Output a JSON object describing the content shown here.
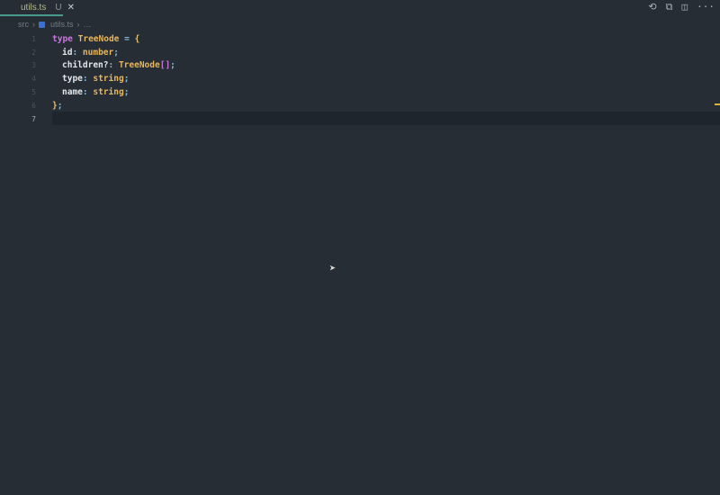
{
  "tab": {
    "filename": "utils.ts",
    "status": "U",
    "close": "✕"
  },
  "actions": {
    "history": "⟲",
    "compare": "⧉",
    "split": "◫",
    "more": "···"
  },
  "breadcrumb": {
    "folder": "src",
    "file": "utils.ts",
    "more": "…"
  },
  "code": {
    "line_numbers": [
      "1",
      "2",
      "3",
      "4",
      "5",
      "6",
      "7"
    ],
    "l1": {
      "kw": "type",
      "name": "TreeNode",
      "eq": "=",
      "open": "{"
    },
    "l2": {
      "prop": "id",
      "colon": ":",
      "type": "number",
      "semi": ";"
    },
    "l3": {
      "prop": "children?",
      "colon": ":",
      "type": "TreeNode",
      "brackets": "[]",
      "semi": ";"
    },
    "l4": {
      "prop": "type",
      "colon": ":",
      "type": "string",
      "semi": ";"
    },
    "l5": {
      "prop": "name",
      "colon": ":",
      "type": "string",
      "semi": ";"
    },
    "l6": {
      "close": "}",
      "semi": ";"
    }
  }
}
